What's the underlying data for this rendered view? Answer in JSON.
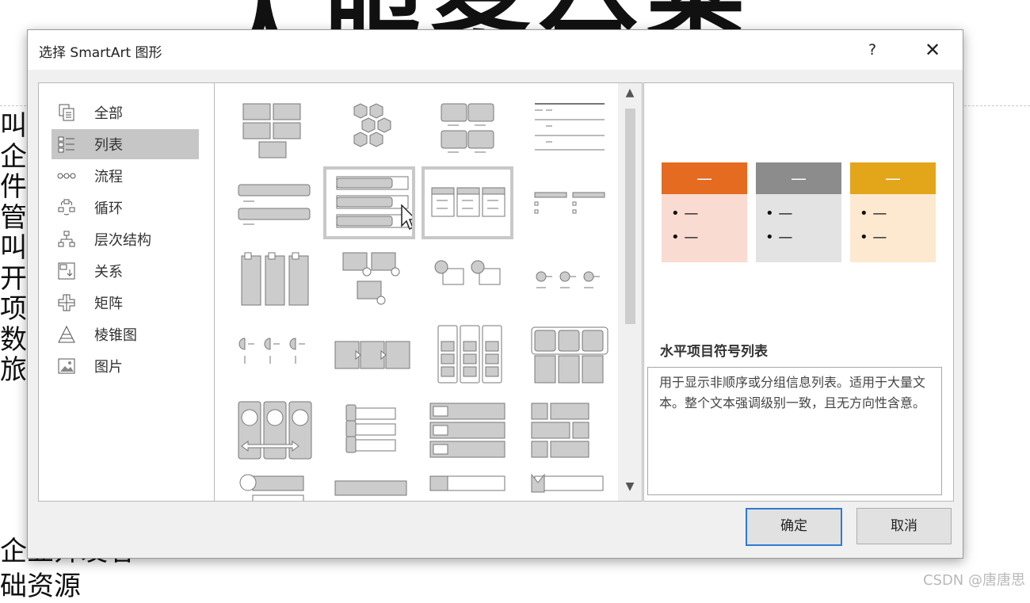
{
  "dialog": {
    "title": "选择 SmartArt 图形",
    "help_label": "?",
    "close_label": "✕"
  },
  "categories": [
    {
      "label": "全部",
      "icon": "all-icon"
    },
    {
      "label": "列表",
      "icon": "list-icon",
      "selected": true
    },
    {
      "label": "流程",
      "icon": "process-icon"
    },
    {
      "label": "循环",
      "icon": "cycle-icon"
    },
    {
      "label": "层次结构",
      "icon": "hierarchy-icon"
    },
    {
      "label": "关系",
      "icon": "relationship-icon"
    },
    {
      "label": "矩阵",
      "icon": "matrix-icon"
    },
    {
      "label": "棱锥图",
      "icon": "pyramid-icon"
    },
    {
      "label": "图片",
      "icon": "picture-icon"
    }
  ],
  "gallery": {
    "selected_index": 5,
    "hover_index": 6,
    "scroll_up_label": "▲",
    "scroll_down_label": "▼"
  },
  "preview": {
    "title": "水平项目符号列表",
    "description": "用于显示非顺序或分组信息列表。适用于大量文本。整个文本强调级别一致，且无方向性含意。",
    "columns": [
      {
        "head_color": "#e46b1f",
        "body_color": "#fadbd2",
        "head_text": "—",
        "bullets": [
          "• —",
          "• —"
        ]
      },
      {
        "head_color": "#8c8c8c",
        "body_color": "#e3e3e3",
        "head_text": "—",
        "bullets": [
          "• —",
          "• —"
        ]
      },
      {
        "head_color": "#e3a51a",
        "body_color": "#fde9cf",
        "head_text": "—",
        "bullets": [
          "• —",
          "• —"
        ]
      }
    ]
  },
  "buttons": {
    "ok_label": "确定",
    "cancel_label": "取消"
  },
  "slide": {
    "title_fragment": "人服务分类",
    "body_lines": [
      "叫",
      "企",
      "件",
      "管",
      "叫",
      "开",
      "项",
      "数",
      "旅"
    ],
    "bottom_lines": [
      "企业开发者",
      "础资源"
    ]
  },
  "watermark": "CSDN @唐唐思"
}
